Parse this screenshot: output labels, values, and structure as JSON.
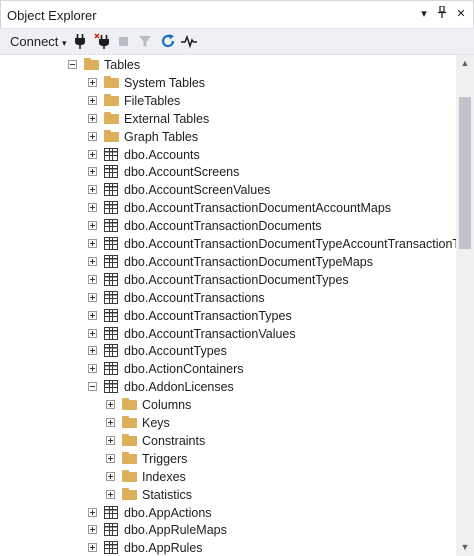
{
  "window": {
    "title": "Object Explorer",
    "controls": {
      "pin": "▾",
      "autohide": "📌",
      "close": "✕"
    }
  },
  "toolbar": {
    "connect_label": "Connect",
    "connect_arrow": "▾",
    "icons": [
      "connect-plug-icon",
      "disconnect-plug-icon",
      "stop-icon",
      "filter-icon",
      "refresh-icon",
      "activity-monitor-icon"
    ]
  },
  "tree": {
    "rows": [
      {
        "label": "Tables",
        "type": "folder",
        "depth": 0,
        "expander": "minus"
      },
      {
        "label": "System Tables",
        "type": "folder",
        "depth": 1,
        "expander": "plus"
      },
      {
        "label": "FileTables",
        "type": "folder",
        "depth": 1,
        "expander": "plus"
      },
      {
        "label": "External Tables",
        "type": "folder",
        "depth": 1,
        "expander": "plus"
      },
      {
        "label": "Graph Tables",
        "type": "folder",
        "depth": 1,
        "expander": "plus"
      },
      {
        "label": "dbo.Accounts",
        "type": "table",
        "depth": 1,
        "expander": "plus"
      },
      {
        "label": "dbo.AccountScreens",
        "type": "table",
        "depth": 1,
        "expander": "plus"
      },
      {
        "label": "dbo.AccountScreenValues",
        "type": "table",
        "depth": 1,
        "expander": "plus"
      },
      {
        "label": "dbo.AccountTransactionDocumentAccountMaps",
        "type": "table",
        "depth": 1,
        "expander": "plus"
      },
      {
        "label": "dbo.AccountTransactionDocuments",
        "type": "table",
        "depth": 1,
        "expander": "plus"
      },
      {
        "label": "dbo.AccountTransactionDocumentTypeAccountTransactionTy",
        "type": "table",
        "depth": 1,
        "expander": "plus"
      },
      {
        "label": "dbo.AccountTransactionDocumentTypeMaps",
        "type": "table",
        "depth": 1,
        "expander": "plus"
      },
      {
        "label": "dbo.AccountTransactionDocumentTypes",
        "type": "table",
        "depth": 1,
        "expander": "plus"
      },
      {
        "label": "dbo.AccountTransactions",
        "type": "table",
        "depth": 1,
        "expander": "plus"
      },
      {
        "label": "dbo.AccountTransactionTypes",
        "type": "table",
        "depth": 1,
        "expander": "plus"
      },
      {
        "label": "dbo.AccountTransactionValues",
        "type": "table",
        "depth": 1,
        "expander": "plus"
      },
      {
        "label": "dbo.AccountTypes",
        "type": "table",
        "depth": 1,
        "expander": "plus"
      },
      {
        "label": "dbo.ActionContainers",
        "type": "table",
        "depth": 1,
        "expander": "plus"
      },
      {
        "label": "dbo.AddonLicenses",
        "type": "table",
        "depth": 1,
        "expander": "minus"
      },
      {
        "label": "Columns",
        "type": "folder",
        "depth": 2,
        "expander": "plus"
      },
      {
        "label": "Keys",
        "type": "folder",
        "depth": 2,
        "expander": "plus"
      },
      {
        "label": "Constraints",
        "type": "folder",
        "depth": 2,
        "expander": "plus"
      },
      {
        "label": "Triggers",
        "type": "folder",
        "depth": 2,
        "expander": "plus"
      },
      {
        "label": "Indexes",
        "type": "folder",
        "depth": 2,
        "expander": "plus"
      },
      {
        "label": "Statistics",
        "type": "folder",
        "depth": 2,
        "expander": "plus"
      },
      {
        "label": "dbo.AppActions",
        "type": "table",
        "depth": 1,
        "expander": "plus"
      },
      {
        "label": "dbo.AppRuleMaps",
        "type": "table",
        "depth": 1,
        "expander": "plus"
      },
      {
        "label": "dbo.AppRules",
        "type": "table",
        "depth": 1,
        "expander": "plus"
      }
    ]
  },
  "colors": {
    "folder": "#dcb05a",
    "toolbar_bg": "#eef0f4",
    "scroll_thumb": "#c2c3c9",
    "refresh": "#1c6fc4"
  }
}
